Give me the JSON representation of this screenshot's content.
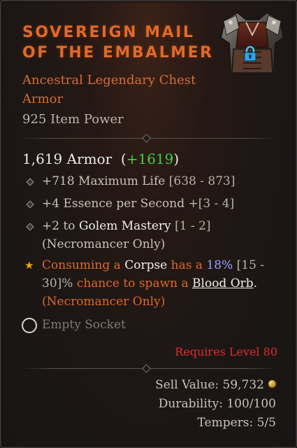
{
  "item": {
    "title_line1": "Sovereign Mail",
    "title_line2": "of the Embalmer",
    "subtype_line1": "Ancestral Legendary Chest",
    "subtype_line2": "Armor",
    "item_power": "925 Item Power",
    "image_icon": "chest-armor-icon",
    "lock_icon": "lock-icon"
  },
  "armor": {
    "value": "1,619 Armor",
    "open": "(",
    "delta": "+1619",
    "close": ")"
  },
  "affixes": [
    {
      "text": "+718 Maximum Life",
      "range": "[638 - 873]"
    },
    {
      "text": "+4 Essence per Second",
      "range": "+[3 - 4]"
    },
    {
      "pre": "+2 to",
      "skill": "Golem Mastery",
      "range": "[1 - 2]",
      "line2": "(Necromancer Only)"
    }
  ],
  "legendary": {
    "p1": "Consuming a",
    "w1": "Corpse",
    "p2": "has a",
    "pct": "18%",
    "r1": "[15 -",
    "r2": "30]%",
    "p3": "chance to spawn a",
    "w2": "Blood Orb",
    "dot": ".",
    "line3": "(Necromancer Only)"
  },
  "socket": {
    "label": "Empty Socket"
  },
  "requirement": "Requires Level 80",
  "stats": {
    "sell": "Sell Value: 59,732",
    "durability": "Durability: 100/100",
    "tempers": "Tempers: 5/5"
  },
  "colors": {
    "title": "#e06a2a",
    "legendary": "#e0682c",
    "bonus": "#3fd33f",
    "requirement": "#e22b2b",
    "percent": "#9aa2ff"
  }
}
